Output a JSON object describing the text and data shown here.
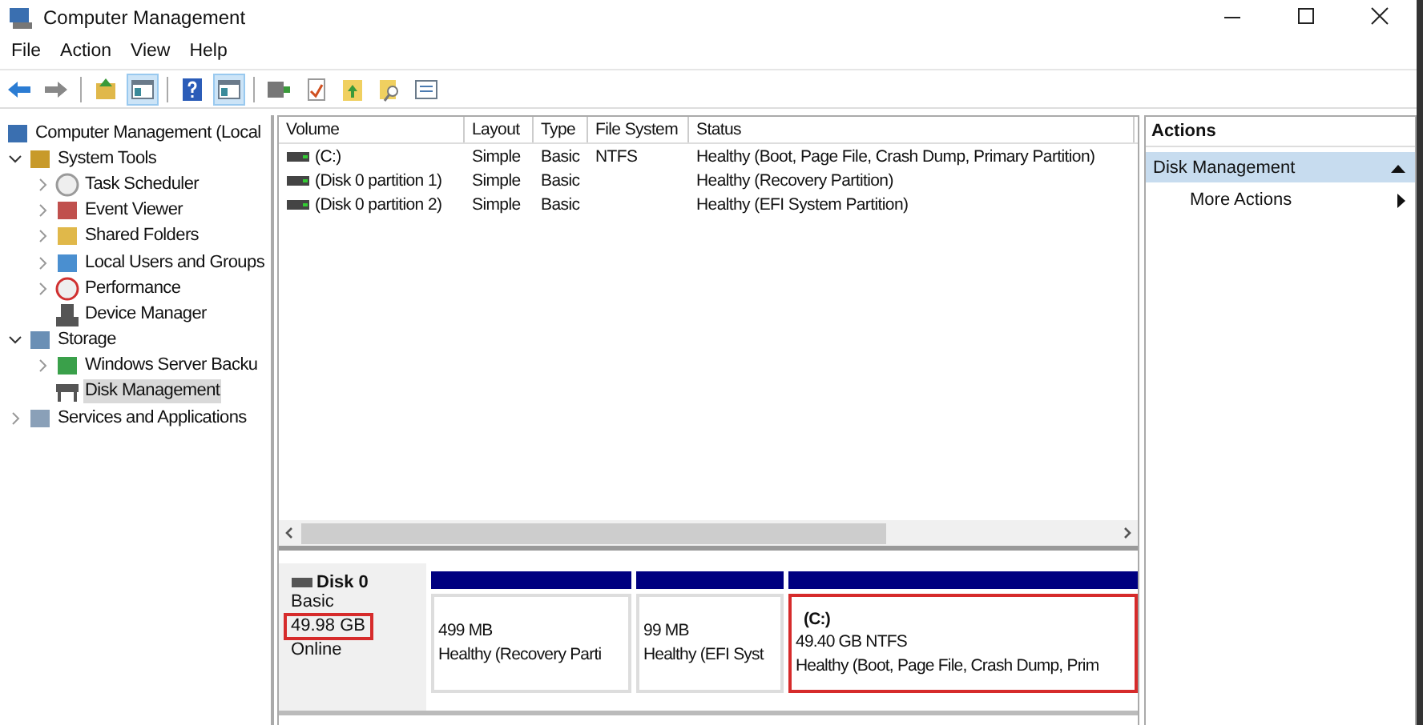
{
  "window": {
    "title": "Computer Management"
  },
  "menu": [
    "File",
    "Action",
    "View",
    "Help"
  ],
  "toolbar": [
    {
      "kind": "back",
      "pressed": false
    },
    {
      "kind": "forward",
      "pressed": false
    },
    {
      "kind": "up",
      "pressed": false
    },
    {
      "kind": "pane",
      "pressed": true
    },
    {
      "kind": "help",
      "pressed": false
    },
    {
      "kind": "pane",
      "pressed": true
    },
    {
      "kind": "connect",
      "pressed": false
    },
    {
      "kind": "check",
      "pressed": false
    },
    {
      "kind": "export",
      "pressed": false
    },
    {
      "kind": "find",
      "pressed": false
    },
    {
      "kind": "list",
      "pressed": false
    }
  ],
  "tree": [
    {
      "label": "Computer Management (Local",
      "kind": "computer",
      "selected": false,
      "children": [
        {
          "label": "System Tools",
          "kind": "tools",
          "expanded": true,
          "selected": false,
          "children": [
            {
              "label": "Task Scheduler",
              "kind": "clock",
              "expanded": false,
              "selected": false
            },
            {
              "label": "Event Viewer",
              "kind": "event",
              "expanded": false,
              "selected": false
            },
            {
              "label": "Shared Folders",
              "kind": "folder",
              "expanded": false,
              "selected": false
            },
            {
              "label": "Local Users and Groups",
              "kind": "users",
              "expanded": false,
              "selected": false
            },
            {
              "label": "Performance",
              "kind": "performance",
              "expanded": false,
              "selected": false
            },
            {
              "label": "Device Manager",
              "kind": "device",
              "selected": false
            }
          ]
        },
        {
          "label": "Storage",
          "kind": "storage",
          "expanded": true,
          "selected": false,
          "children": [
            {
              "label": "Windows Server Backu",
              "kind": "backup",
              "expanded": false,
              "selected": false
            },
            {
              "label": "Disk Management",
              "kind": "disk",
              "selected": true
            }
          ]
        },
        {
          "label": "Services and Applications",
          "kind": "services",
          "expanded": false,
          "selected": false
        }
      ]
    }
  ],
  "table": {
    "columns": [
      "Volume",
      "Layout",
      "Type",
      "File System",
      "Status"
    ],
    "rows": [
      [
        "(C:)",
        "Simple",
        "Basic",
        "NTFS",
        "Healthy (Boot, Page File, Crash Dump, Primary Partition)"
      ],
      [
        "(Disk 0 partition 1)",
        "Simple",
        "Basic",
        "",
        "Healthy (Recovery Partition)"
      ],
      [
        "(Disk 0 partition 2)",
        "Simple",
        "Basic",
        "",
        "Healthy (EFI System Partition)"
      ]
    ]
  },
  "disks": [
    {
      "name": "Disk 0",
      "type": "Basic",
      "size": "49.98 GB",
      "status": "Online",
      "size_highlighted": true,
      "partitions": [
        {
          "size": "499 MB",
          "status": "Healthy (Recovery Parti",
          "highlighted": false
        },
        {
          "size": "99 MB",
          "status": "Healthy (EFI Syst",
          "highlighted": false
        },
        {
          "title": "(C:)",
          "size": "49.40 GB NTFS",
          "status": "Healthy (Boot, Page File, Crash Dump, Prim",
          "highlighted": true
        }
      ]
    }
  ],
  "actions": {
    "title": "Actions",
    "sections": [
      {
        "label": "Disk Management",
        "selected": true,
        "items": [
          "More Actions"
        ]
      }
    ]
  }
}
